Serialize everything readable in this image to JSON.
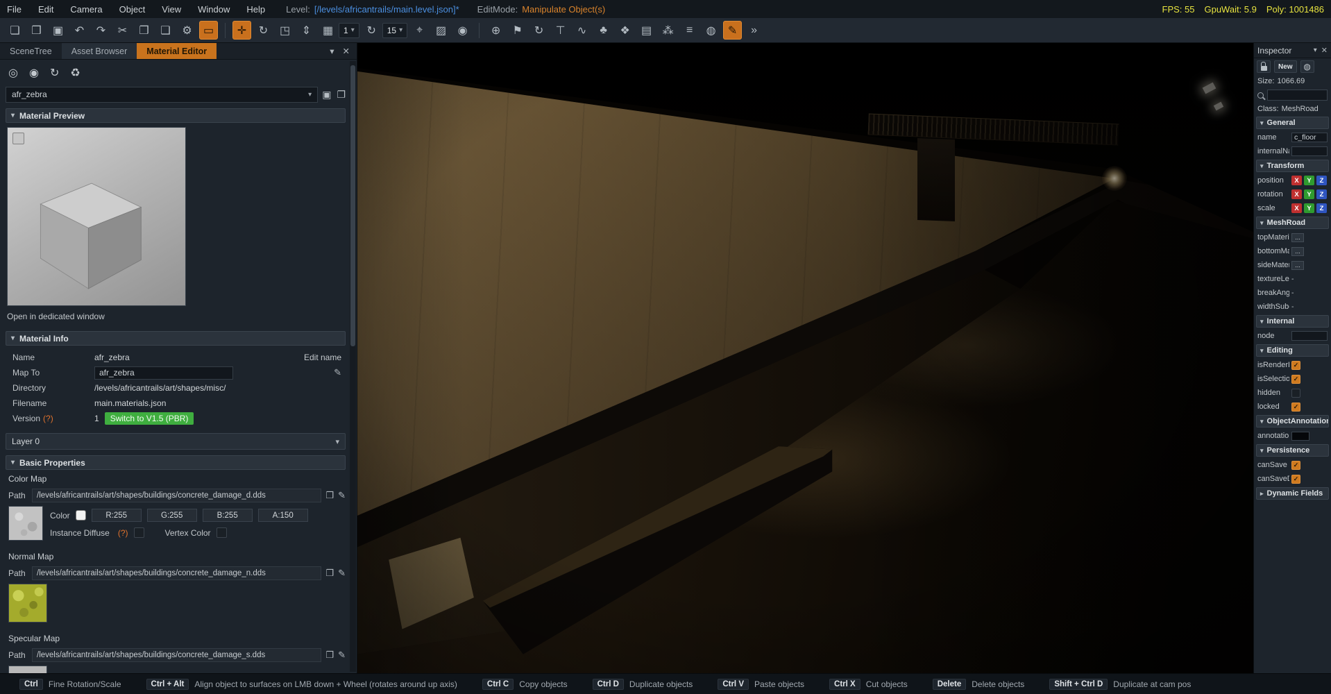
{
  "ui": {
    "caret_down": "▾",
    "caret_right": "▸",
    "close": "✕",
    "world": "◍",
    "folder": "❒",
    "pencil": "✎"
  },
  "colors": {
    "accent": "#c9731d",
    "level_path_blue": "#4b8fe0",
    "editmode_orange": "#d9832c",
    "stats_yellow": "#e7e33f",
    "switch_green": "#3fae3f"
  },
  "menubar": {
    "menus": [
      "File",
      "Edit",
      "Camera",
      "Object",
      "View",
      "Window",
      "Help"
    ],
    "level_label": "Level:",
    "level_value": "[/levels/africantrails/main.level.json]*",
    "editmode_label": "EditMode:",
    "editmode_value": "Manipulate Object(s)",
    "stats": {
      "fps": "FPS: 55",
      "gpu": "GpuWait: 5.9",
      "poly": "Poly: 1001486"
    }
  },
  "toolbar": {
    "file_icons": [
      {
        "name": "new-file-icon",
        "glyph": "❏"
      },
      {
        "name": "open-folder-icon",
        "glyph": "❒"
      },
      {
        "name": "save-icon",
        "glyph": "▣"
      },
      {
        "name": "undo-icon",
        "glyph": "↶"
      },
      {
        "name": "redo-icon",
        "glyph": "↷"
      },
      {
        "name": "cut-icon",
        "glyph": "✂"
      },
      {
        "name": "copy-icon",
        "glyph": "❐"
      },
      {
        "name": "paste-icon",
        "glyph": "❑"
      },
      {
        "name": "settings-icon",
        "glyph": "⚙"
      },
      {
        "name": "screenshot-icon",
        "glyph": "▭",
        "accent": true
      }
    ],
    "gizmo_icons": [
      {
        "name": "move-tool-icon",
        "glyph": "✛",
        "accent": true
      },
      {
        "name": "rotate-tool-icon",
        "glyph": "↻"
      },
      {
        "name": "bounds-tool-icon",
        "glyph": "◳"
      },
      {
        "name": "scale-tool-icon",
        "glyph": "⇕"
      }
    ],
    "snap_grid": {
      "icon": "▦",
      "value": "1"
    },
    "snap_rotate": {
      "icon": "↻",
      "value": "15"
    },
    "view_icons": [
      {
        "name": "player-view-icon",
        "glyph": "⌖"
      },
      {
        "name": "terrain-paint-icon",
        "glyph": "▨"
      },
      {
        "name": "camera-icon",
        "glyph": "◉"
      }
    ],
    "object_icons": [
      {
        "name": "add-object-icon",
        "glyph": "⊕"
      },
      {
        "name": "flag-icon",
        "glyph": "⚑"
      },
      {
        "name": "rotate-cw-icon",
        "glyph": "↻"
      },
      {
        "name": "text-tool-icon",
        "glyph": "⊤"
      },
      {
        "name": "road-tool-icon",
        "glyph": "∿"
      },
      {
        "name": "forest-tool-icon",
        "glyph": "♣"
      },
      {
        "name": "mesh-tool-icon",
        "glyph": "❖"
      },
      {
        "name": "decal-tool-icon",
        "glyph": "▤"
      },
      {
        "name": "crowd-tool-icon",
        "glyph": "⁂"
      },
      {
        "name": "layers-icon",
        "glyph": "≡"
      },
      {
        "name": "world-icon",
        "glyph": "◍"
      },
      {
        "name": "brush-tool-icon",
        "glyph": "✎",
        "accent": true
      },
      {
        "name": "more-tools-icon",
        "glyph": "»"
      }
    ]
  },
  "left_panel": {
    "tabs": [
      {
        "label": "SceneTree"
      },
      {
        "label": "Asset Browser",
        "mid": true
      },
      {
        "label": "Material Editor",
        "active": true
      }
    ],
    "tools": [
      {
        "name": "reload-all-materials-icon",
        "glyph": "◎"
      },
      {
        "name": "locate-material-icon",
        "glyph": "◉"
      },
      {
        "name": "refresh-icon",
        "glyph": "↻"
      },
      {
        "name": "delete-material-icon",
        "glyph": "♻"
      }
    ],
    "material_select": {
      "value": "afr_zebra",
      "icons": [
        {
          "name": "save-material-icon",
          "glyph": "▣"
        },
        {
          "name": "copy-material-icon",
          "glyph": "❐"
        }
      ]
    },
    "preview": {
      "header": "Material Preview",
      "open_link": "Open in dedicated window"
    },
    "info": {
      "header": "Material Info",
      "name_label": "Name",
      "name_value": "afr_zebra",
      "edit_name": "Edit name",
      "mapto_label": "Map To",
      "mapto_value": "afr_zebra",
      "dir_label": "Directory",
      "dir_value": "/levels/africantrails/art/shapes/misc/",
      "file_label": "Filename",
      "file_value": "main.materials.json",
      "version_label": "Version",
      "version_hint": "(?)",
      "version_value": "1",
      "switch_button": "Switch to V1.5 (PBR)"
    },
    "layer": {
      "label": "Layer 0"
    },
    "basic": {
      "header": "Basic Properties"
    },
    "color_map": {
      "label": "Color Map",
      "path_label": "Path",
      "path": "/levels/africantrails/art/shapes/buildings/concrete_damage_d.dds",
      "color_label": "Color",
      "r": "R:255",
      "g": "G:255",
      "b": "B:255",
      "a": "A:150",
      "instance_diffuse": "Instance Diffuse",
      "hint": "(?)",
      "vertex_color": "Vertex Color"
    },
    "normal_map": {
      "label": "Normal Map",
      "path_label": "Path",
      "path": "/levels/africantrails/art/shapes/buildings/concrete_damage_n.dds"
    },
    "specular_map": {
      "label": "Specular Map",
      "path_label": "Path",
      "path": "/levels/africantrails/art/shapes/buildings/concrete_damage_s.dds"
    }
  },
  "inspector": {
    "title": "Inspector",
    "new_button": "New",
    "size_label": "Size:",
    "size_value": "1066.69",
    "class_label": "Class:",
    "class_value": "MeshRoad",
    "general": {
      "title": "General",
      "rows": [
        {
          "label": "name",
          "value": "c_floor"
        },
        {
          "label": "internalName",
          "value": ""
        }
      ]
    },
    "transform": {
      "title": "Transform",
      "axes": [
        "X",
        "Y",
        "Z"
      ],
      "rows": [
        {
          "label": "position"
        },
        {
          "label": "rotation"
        },
        {
          "label": "scale"
        }
      ]
    },
    "meshroad": {
      "title": "MeshRoad",
      "rows": [
        {
          "label": "topMaterial",
          "btn": "..."
        },
        {
          "label": "bottomMaterial",
          "btn": "..."
        },
        {
          "label": "sideMaterial",
          "btn": "..."
        },
        {
          "label": "textureLength",
          "value": "-"
        },
        {
          "label": "breakAngle",
          "value": "-"
        },
        {
          "label": "widthSubdivisions",
          "value": "-"
        }
      ]
    },
    "internal": {
      "title": "Internal",
      "rows": [
        {
          "label": "node",
          "value": ""
        }
      ]
    },
    "editing": {
      "title": "Editing",
      "rows": [
        {
          "label": "isRenderEnabled",
          "checked": true
        },
        {
          "label": "isSelectionEnabled",
          "checked": true
        },
        {
          "label": "hidden",
          "checked": false
        },
        {
          "label": "locked",
          "checked": true
        }
      ]
    },
    "objectanno": {
      "title": "ObjectAnnotation",
      "rows": [
        {
          "label": "annotation"
        }
      ]
    },
    "persistence": {
      "title": "Persistence",
      "rows": [
        {
          "label": "canSave",
          "checked": true
        },
        {
          "label": "canSaveDynamicFields",
          "checked": true
        }
      ]
    },
    "dynamic": {
      "title": "Dynamic Fields"
    }
  },
  "status_bar": {
    "shortcuts": [
      {
        "key": "Ctrl",
        "desc": "Fine Rotation/Scale"
      },
      {
        "key": "Ctrl + Alt",
        "desc": "Align object to surfaces on LMB down + Wheel (rotates around up axis)"
      },
      {
        "key": "Ctrl C",
        "desc": "Copy objects"
      },
      {
        "key": "Ctrl D",
        "desc": "Duplicate objects"
      },
      {
        "key": "Ctrl V",
        "desc": "Paste objects"
      },
      {
        "key": "Ctrl X",
        "desc": "Cut objects"
      },
      {
        "key": "Delete",
        "desc": "Delete objects"
      },
      {
        "key": "Shift + Ctrl D",
        "desc": "Duplicate at cam pos"
      }
    ]
  }
}
